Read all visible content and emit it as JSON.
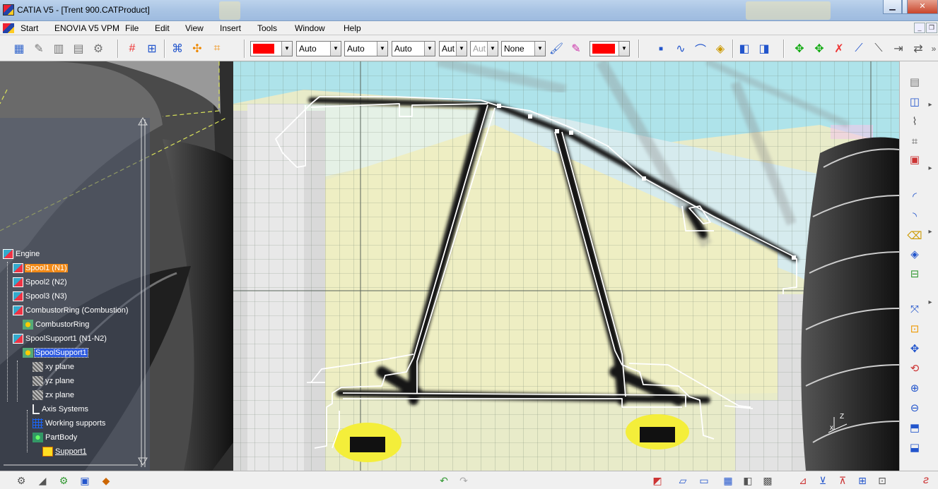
{
  "window": {
    "title": "CATIA V5 - [Trent 900.CATProduct]",
    "minimize_glyph": "▁",
    "maximize_glyph": "▢",
    "close_glyph": "✕"
  },
  "menu": {
    "items": [
      "Start",
      "ENOVIA V5 VPM",
      "File",
      "Edit",
      "View",
      "Insert",
      "Tools",
      "Window",
      "Help"
    ],
    "mdi_minimize": "_",
    "mdi_restore": "❐",
    "mdi_close": "✕"
  },
  "graphic_properties": {
    "fill_color": "#ff0000",
    "transparency": "Auto",
    "line_thickness": "Auto",
    "line_type": "Auto",
    "point_type": "Aut",
    "point_type_disabled": "Aut",
    "layer": "None",
    "line_color": "#ff0000"
  },
  "tree": {
    "nodes": [
      {
        "label": "Engine",
        "icon": "product"
      },
      {
        "label": "Spool1 (N1)",
        "icon": "product",
        "state": "selected-orange"
      },
      {
        "label": "Spool2 (N2)",
        "icon": "product"
      },
      {
        "label": "Spool3 (N3)",
        "icon": "product"
      },
      {
        "label": "CombustorRing (Combustion)",
        "icon": "product"
      },
      {
        "label": "CombustorRing",
        "icon": "part"
      },
      {
        "label": "SpoolSupport1 (N1-N2)",
        "icon": "product"
      },
      {
        "label": "SpoolSupport1",
        "icon": "part",
        "state": "selected-blue"
      },
      {
        "label": "xy plane",
        "icon": "plane"
      },
      {
        "label": "yz plane",
        "icon": "plane"
      },
      {
        "label": "zx plane",
        "icon": "plane"
      },
      {
        "label": "Axis Systems",
        "icon": "axis"
      },
      {
        "label": "Working supports",
        "icon": "grid"
      },
      {
        "label": "PartBody",
        "icon": "body"
      },
      {
        "label": "Support1",
        "icon": "support",
        "state": "underline"
      }
    ]
  },
  "compass": {
    "z_label": "Z",
    "x_label": "x"
  },
  "colors": {
    "accent_selection": "#2d5ae0",
    "tree_highlight": "#f28a17",
    "sketch_profile": "#ffffff",
    "grid_lines": "#6b7a6b",
    "viewport_bg": "#e9ebd0"
  }
}
